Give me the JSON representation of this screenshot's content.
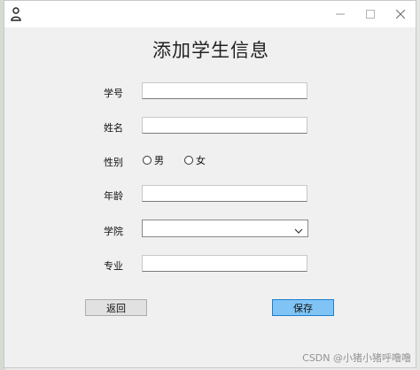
{
  "form": {
    "title": "添加学生信息",
    "labels": {
      "student_id": "学号",
      "name": "姓名",
      "gender": "性别",
      "age": "年龄",
      "college": "学院",
      "major": "专业"
    },
    "gender_options": [
      "男",
      "女"
    ],
    "values": {
      "student_id": "",
      "name": "",
      "age": "",
      "college": "",
      "major": ""
    }
  },
  "buttons": {
    "back": "返回",
    "save": "保存"
  },
  "watermark": "CSDN @小猪小猪呼噜噜",
  "colors": {
    "save_button_bg": "#7fc4f5",
    "save_button_border": "#1e7fd0",
    "back_button_bg": "#e1e1e1"
  },
  "icons": [
    "app-user-icon",
    "minimize-icon",
    "maximize-icon",
    "close-icon",
    "chevron-down-icon"
  ]
}
